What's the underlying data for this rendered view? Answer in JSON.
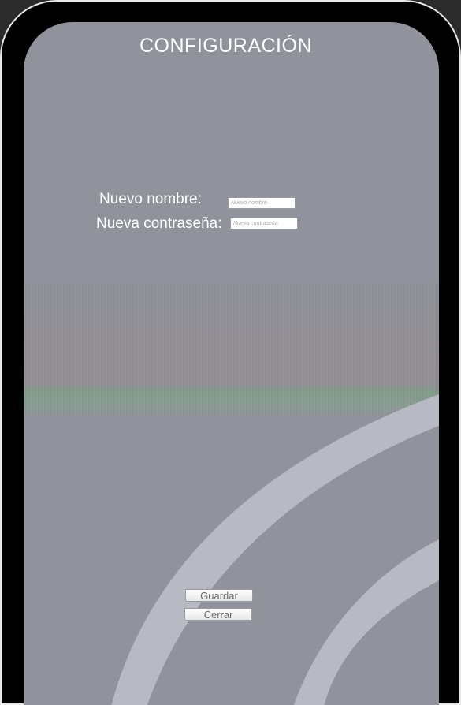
{
  "screen": {
    "title": "CONFIGURACIÓN"
  },
  "form": {
    "name_label": "Nuevo nombre:",
    "name_placeholder": "Nuevo nombre",
    "name_value": "",
    "password_label": "Nueva contraseña:",
    "password_placeholder": "Nueva contraseña",
    "password_value": ""
  },
  "buttons": {
    "save_label": "Guardar",
    "close_label": "Cerrar"
  },
  "colors": {
    "background": "#90939b",
    "frame": "#000000",
    "text": "#ffffff",
    "swoosh": "#b7bac2"
  }
}
